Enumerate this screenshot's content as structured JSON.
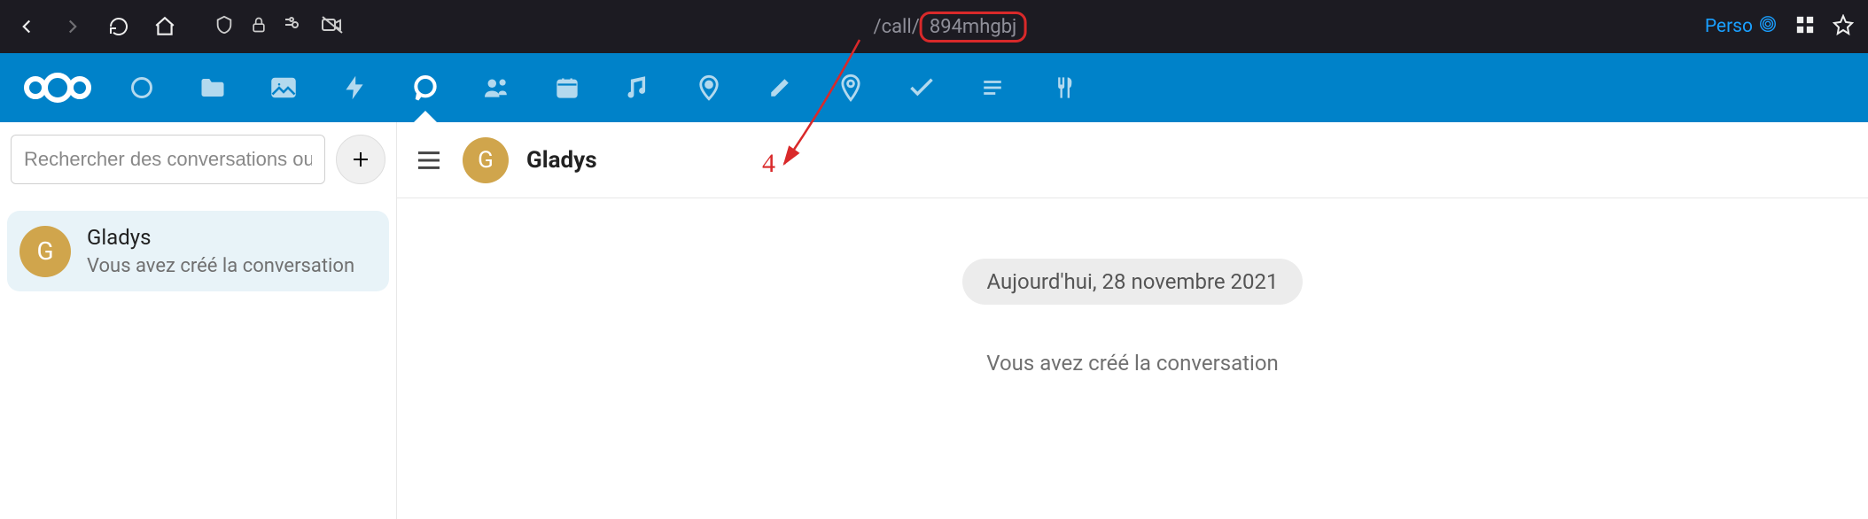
{
  "browser": {
    "url_prefix": "/call/",
    "url_highlight": "894mhgbj",
    "profile_label": "Perso"
  },
  "sidebar": {
    "search_placeholder": "Rechercher des conversations ou des",
    "conversations": [
      {
        "initial": "G",
        "name": "Gladys",
        "subtitle": "Vous avez créé la conversation"
      }
    ]
  },
  "chat": {
    "avatar_initial": "G",
    "title": "Gladys",
    "date_label": "Aujourd'hui, 28 novembre 2021",
    "system_message": "Vous avez créé la conversation"
  },
  "annotation": {
    "number": "4"
  }
}
